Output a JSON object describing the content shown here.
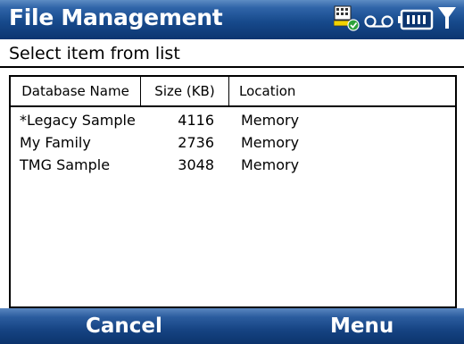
{
  "app": {
    "title": "File Management"
  },
  "status_icons": [
    "network-sync-icon",
    "voicemail-icon",
    "battery-icon",
    "signal-icon"
  ],
  "colors": {
    "title_bar": "#174a8c",
    "softkey_bar": "#164483",
    "text": "#000000"
  },
  "prompt": "Select item from list",
  "list": {
    "columns": [
      "Database Name",
      "Size (KB)",
      "Location"
    ],
    "rows": [
      {
        "name": "*Legacy Sample",
        "size": "4116",
        "location": "Memory"
      },
      {
        "name": "My Family",
        "size": "2736",
        "location": "Memory"
      },
      {
        "name": "TMG Sample",
        "size": "3048",
        "location": "Memory"
      }
    ]
  },
  "softkeys": {
    "left": "Cancel",
    "right": "Menu"
  }
}
